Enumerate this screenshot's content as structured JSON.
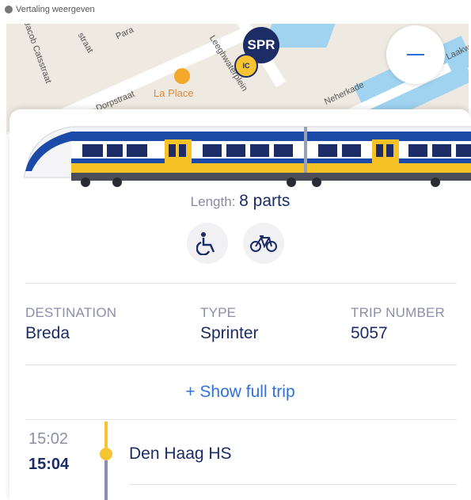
{
  "translate_bar": {
    "label": "Vertaling weergeven"
  },
  "map": {
    "streets": [
      "Jacob Catsstraat",
      "Para",
      "straat",
      "Dorpstraat",
      "Leeghwaterplein",
      "Neherkade",
      "Laakw"
    ],
    "place": "La Place",
    "vehicle_badges": {
      "spr": "SPR",
      "ic": "IC"
    }
  },
  "train": {
    "length_label": "Length:",
    "length_value": "8 parts",
    "facilities": [
      "wheelchair-icon",
      "bicycle-icon"
    ]
  },
  "details": {
    "destination_label": "DESTINATION",
    "destination_value": "Breda",
    "type_label": "TYPE",
    "type_value": "Sprinter",
    "trip_label": "TRIP NUMBER",
    "trip_value": "5057"
  },
  "show_full_trip": "+ Show full trip",
  "stops": [
    {
      "scheduled": "15:02",
      "actual": "15:04",
      "name": "Den Haag HS"
    }
  ],
  "colors": {
    "ns_blue": "#1b2c66",
    "ns_yellow": "#f5c431",
    "link_blue": "#2f72d8",
    "muted": "#8d8fa6"
  }
}
